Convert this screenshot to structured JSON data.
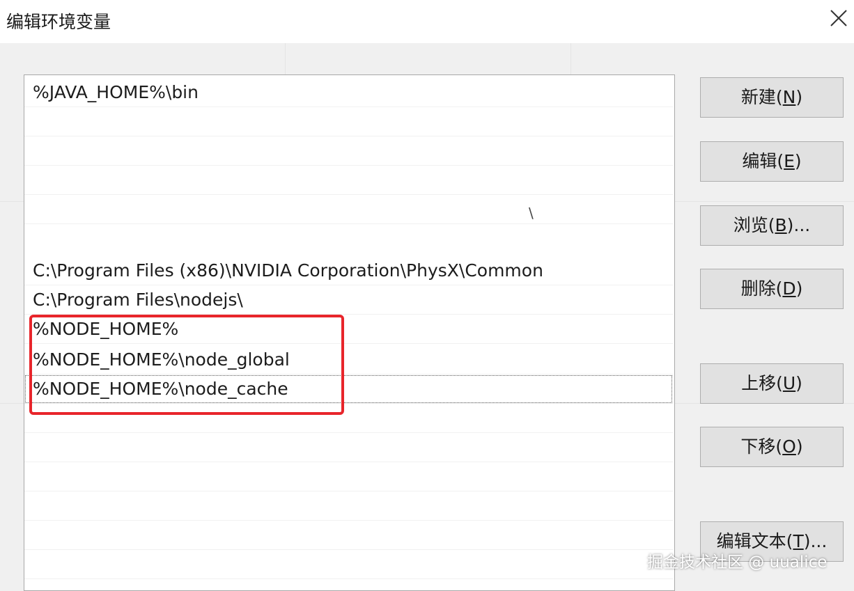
{
  "window": {
    "title": "编辑环境变量",
    "close_icon": "close-icon"
  },
  "path_list": {
    "entries": [
      "%JAVA_HOME%\\bin",
      "",
      "",
      "",
      "",
      "C:\\Program Files (x86)\\NVIDIA Corporation\\PhysX\\Common",
      "C:\\Program Files\\nodejs\\",
      "%NODE_HOME%",
      "%NODE_HOME%\\node_global",
      "%NODE_HOME%\\node_cache"
    ],
    "stray_fragment": "\\",
    "selected_index": 9,
    "highlight_color": "#e8252b"
  },
  "buttons": {
    "new": {
      "text": "新建(",
      "key": "N",
      "end": ")"
    },
    "edit": {
      "text": "编辑(",
      "key": "E",
      "end": ")"
    },
    "browse": {
      "text": "浏览(",
      "key": "B",
      "end": ")..."
    },
    "delete": {
      "text": "删除(",
      "key": "D",
      "end": ")"
    },
    "move_up": {
      "text": "上移(",
      "key": "U",
      "end": ")"
    },
    "move_down": {
      "text": "下移(",
      "key": "O",
      "end": ")"
    },
    "edit_text": {
      "text": "编辑文本(",
      "key": "T",
      "end": ")..."
    }
  },
  "watermark": "掘金技术社区 @ uualice"
}
